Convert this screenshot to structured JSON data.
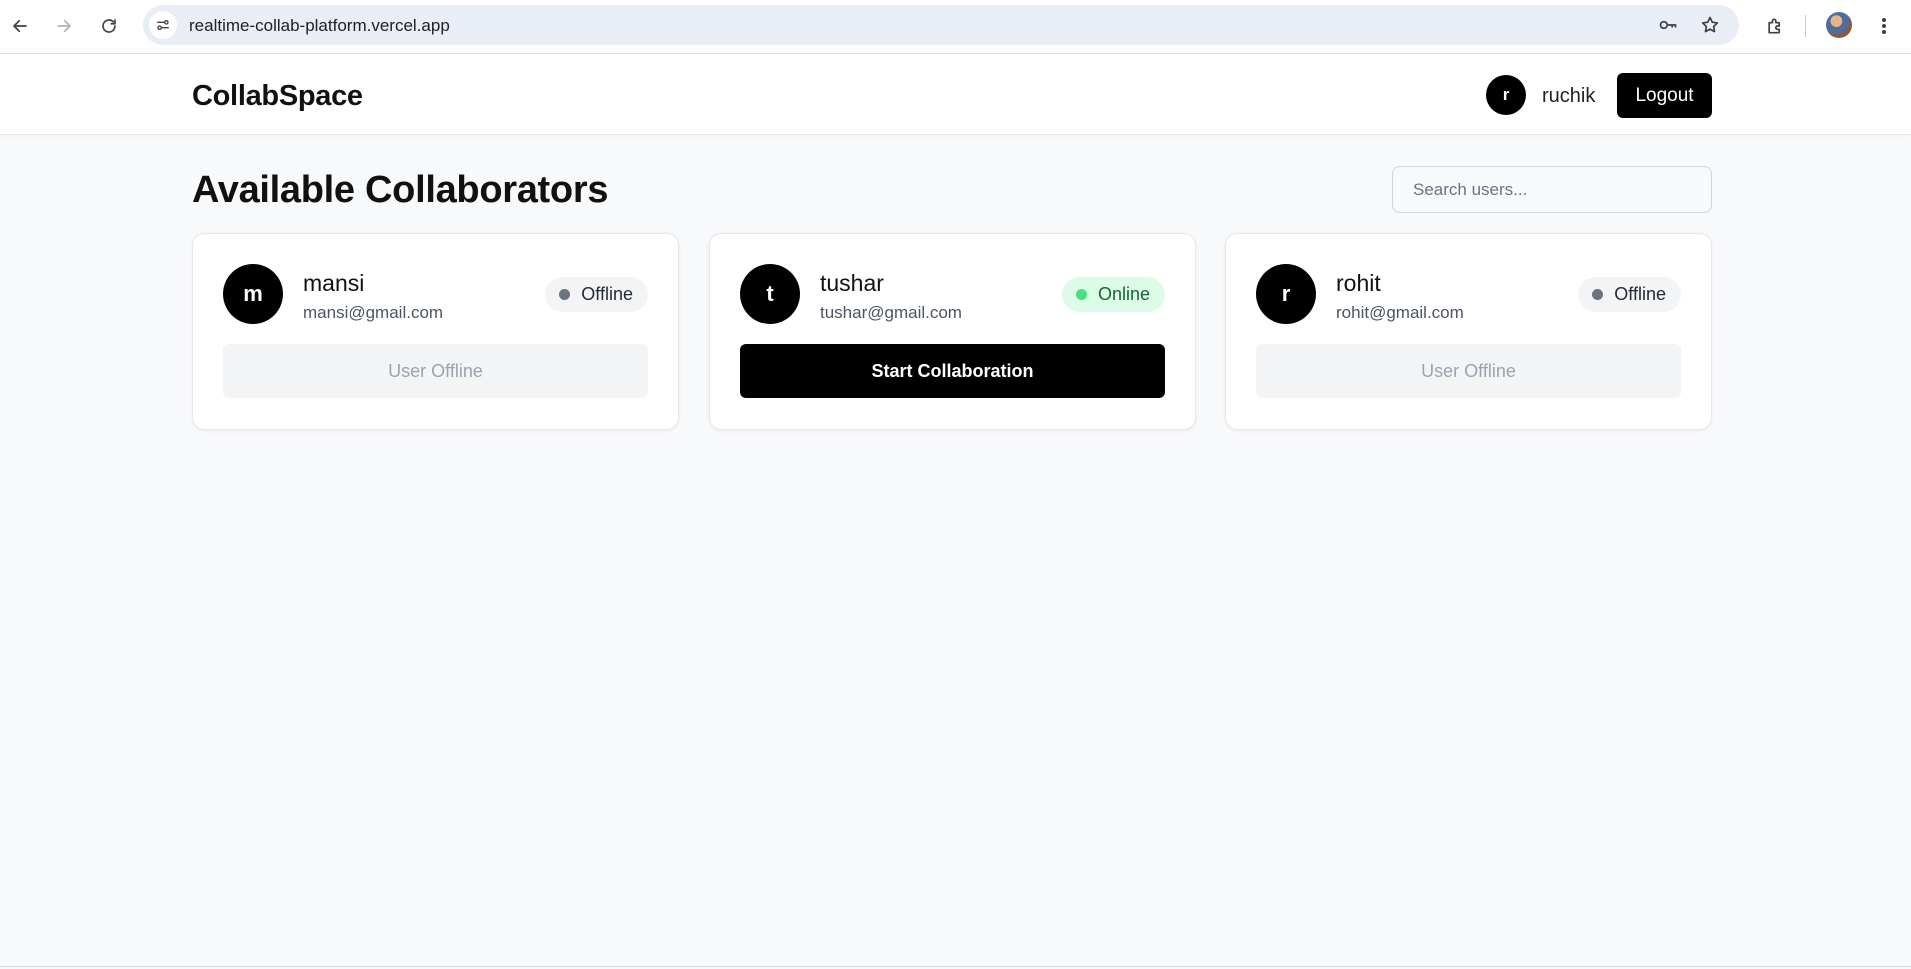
{
  "browser": {
    "url": "realtime-collab-platform.vercel.app",
    "icons": [
      "back-arrow-icon",
      "forward-arrow-icon",
      "reload-icon",
      "site-info-icon",
      "password-key-icon",
      "bookmark-star-icon",
      "extensions-icon",
      "profile-avatar",
      "more-vert-icon"
    ]
  },
  "header": {
    "brand": "CollabSpace",
    "current_user": {
      "initial": "r",
      "name": "ruchik"
    },
    "logout_label": "Logout"
  },
  "main": {
    "title": "Available Collaborators",
    "search_placeholder": "Search users..."
  },
  "users": [
    {
      "initial": "m",
      "name": "mansi",
      "email": "mansi@gmail.com",
      "status": "Offline",
      "action": "User Offline"
    },
    {
      "initial": "t",
      "name": "tushar",
      "email": "tushar@gmail.com",
      "status": "Online",
      "action": "Start Collaboration"
    },
    {
      "initial": "r",
      "name": "rohit",
      "email": "rohit@gmail.com",
      "status": "Offline",
      "action": "User Offline"
    }
  ],
  "colors": {
    "primary": "#000000",
    "online_bg": "#dcfce7",
    "online_dot": "#4ade80",
    "offline_dot": "#6b7280",
    "page_bg": "#f8f9fb"
  }
}
